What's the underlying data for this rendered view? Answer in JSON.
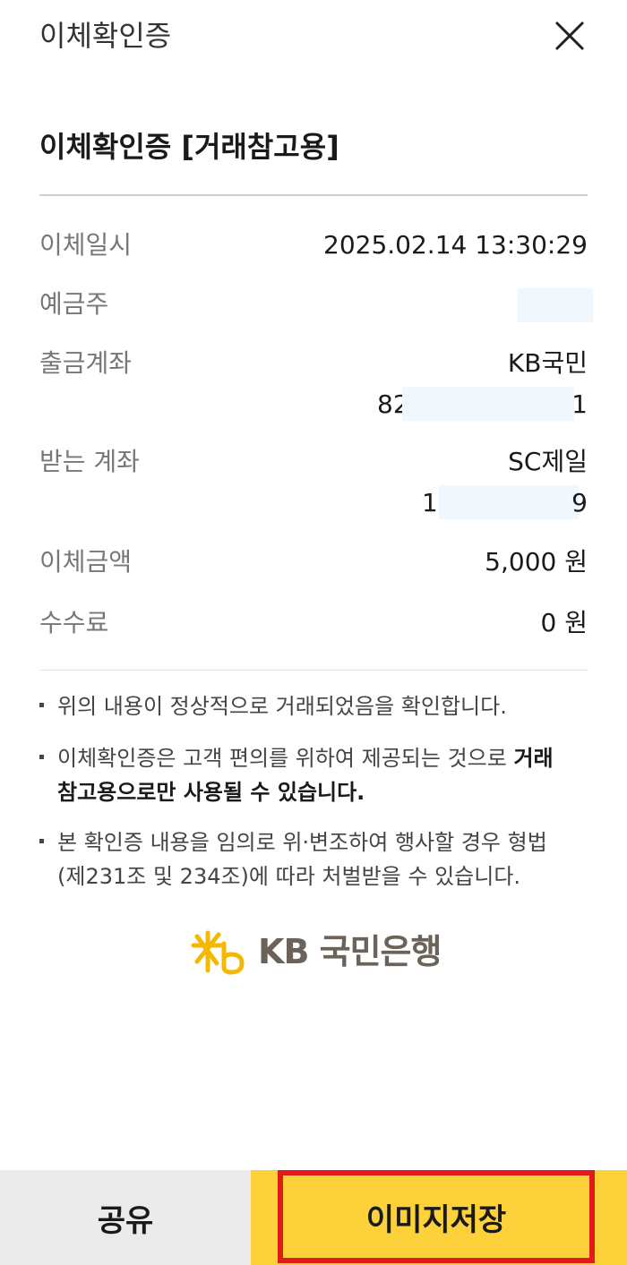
{
  "header": {
    "title": "이체확인증",
    "close_icon": "close-icon"
  },
  "document": {
    "title": "이체확인증 [거래참고용]"
  },
  "details": {
    "transfer_date_label": "이체일시",
    "transfer_date_value": "2025.02.14 13:30:29",
    "depositor_label": "예금주",
    "depositor_value": "",
    "from_account_label": "출금계좌",
    "from_bank": "KB국민",
    "from_account_prefix": "82",
    "from_account_suffix": "1",
    "to_account_label": "받는 계좌",
    "to_bank": "SC제일",
    "to_account_prefix": "1",
    "to_account_suffix": "9",
    "amount_label": "이체금액",
    "amount_value": "5,000 원",
    "fee_label": "수수료",
    "fee_value": "0 원"
  },
  "notes": {
    "note1": "위의 내용이 정상적으로 거래되었음을 확인합니다.",
    "note2_part1": "이체확인증은 고객 편의를 위하여 제공되는 것으로 ",
    "note2_bold": "거래 참고용으로만 사용될 수 있습니다.",
    "note3": "본 확인증 내용을 임의로 위·변조하여 행사할 경우 형법 (제231조 및 234조)에 따라 처벌받을 수 있습니다."
  },
  "logo": {
    "text": "KB 국민은행",
    "icon": "kb-star-icon",
    "icon_color": "#f5b800",
    "text_color": "#6b625a"
  },
  "actions": {
    "share_label": "공유",
    "save_label": "이미지저장"
  },
  "colors": {
    "save_button_bg": "#fdd13a",
    "share_button_bg": "#ebebeb",
    "highlight_border": "#e21a1a",
    "masked_field": "#f1f8fd"
  }
}
